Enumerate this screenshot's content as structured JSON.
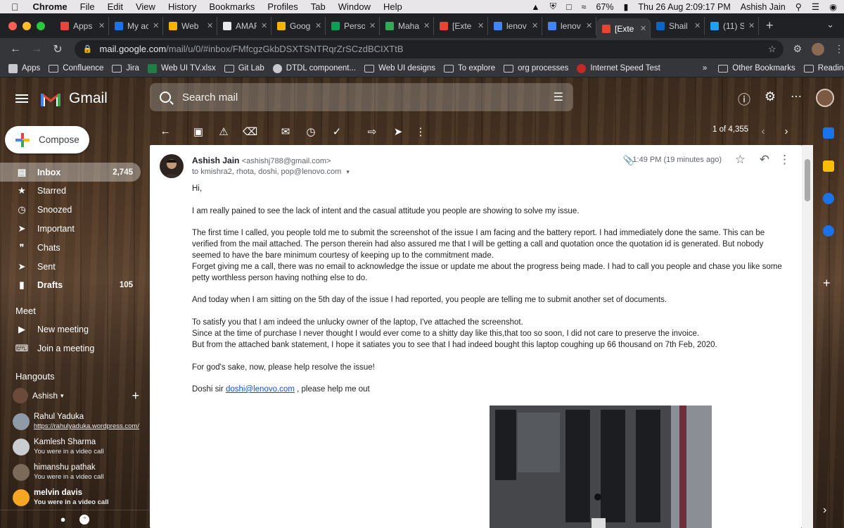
{
  "menubar": {
    "app": "Chrome",
    "items": [
      "File",
      "Edit",
      "View",
      "History",
      "Bookmarks",
      "Profiles",
      "Tab",
      "Window",
      "Help"
    ],
    "battery": "67%",
    "datetime": "Thu 26 Aug  2:09:17 PM",
    "user": "Ashish Jain"
  },
  "tabs": [
    {
      "label": "Apps",
      "color": "#e8453c"
    },
    {
      "label": "My ac",
      "color": "#1a73e8"
    },
    {
      "label": "Web",
      "color": "#f4b400"
    },
    {
      "label": "AMAF",
      "color": "#e8eaed"
    },
    {
      "label": "Goog",
      "color": "#f4b400"
    },
    {
      "label": "Perso",
      "color": "#0f9d58"
    },
    {
      "label": "Maha",
      "color": "#34a853"
    },
    {
      "label": "[Exte",
      "color": "#ea4335"
    },
    {
      "label": "lenov",
      "color": "#4285f4"
    },
    {
      "label": "lenov",
      "color": "#4285f4"
    },
    {
      "label": "[Exte",
      "color": "#ea4335"
    },
    {
      "label": "Shail",
      "color": "#0a66c2"
    },
    {
      "label": "(11) S",
      "color": "#1da1f2"
    }
  ],
  "address": {
    "host": "mail.google.com",
    "path": "/mail/u/0/#inbox/FMfcgzGkbDSXTSNTRqrZrSCzdBCIXTtB"
  },
  "bookmarks": [
    "Apps",
    "Confluence",
    "Jira",
    "Web UI TV.xlsx",
    "Git Lab",
    "DTDL component...",
    "Web UI designs",
    "To explore",
    "org processes",
    "Internet Speed Test"
  ],
  "bookmarks_more": "»",
  "bookmarks_right": [
    "Other Bookmarks",
    "Reading List"
  ],
  "gmail": {
    "logo": "Gmail",
    "search_placeholder": "Search mail",
    "compose": "Compose"
  },
  "nav": [
    {
      "label": "Inbox",
      "count": "2,745",
      "icon": "inbox-icon"
    },
    {
      "label": "Starred",
      "count": "",
      "icon": "star-icon"
    },
    {
      "label": "Snoozed",
      "count": "",
      "icon": "clock-icon"
    },
    {
      "label": "Important",
      "count": "",
      "icon": "important-icon"
    },
    {
      "label": "Chats",
      "count": "",
      "icon": "chat-icon"
    },
    {
      "label": "Sent",
      "count": "",
      "icon": "send-icon"
    },
    {
      "label": "Drafts",
      "count": "105",
      "icon": "draft-icon"
    }
  ],
  "meet": {
    "title": "Meet",
    "new_meeting": "New meeting",
    "join_meeting": "Join a meeting"
  },
  "hangouts": {
    "title": "Hangouts",
    "me": "Ashish",
    "contacts": [
      {
        "name": "Rahul Yaduka",
        "status": "https://rahulyaduka.wordpress.com/",
        "color": "#8e9aa6"
      },
      {
        "name": "Kamlesh Sharma",
        "status": "You were in a video call",
        "color": "#c9ccd0"
      },
      {
        "name": "himanshu pathak",
        "status": "You were in a video call",
        "color": "#7b6a5a"
      },
      {
        "name": "melvin davis",
        "status": "You were in a video call",
        "color": "#f5a623"
      }
    ]
  },
  "pager": "1 of 4,355",
  "email": {
    "sender_name": "Ashish Jain",
    "sender_email": "<ashishj788@gmail.com>",
    "to": "to kmishra2, rhota, doshi, pop@lenovo.com",
    "time": "1:49 PM (19 minutes ago)",
    "greeting": "Hi,",
    "p1": "I am really pained to see the lack of intent and the casual attitude you people are showing to solve my issue.",
    "p2": "The first time I called, you people told me to submit the screenshot of the issue I am facing and the battery report. I had immediately done the same. This can be verified from the mail attached. The person therein had also assured me that I will be getting a call and quotation once the quotation id is generated. But nobody seemed to have the bare minimum courtesy of keeping up to the commitment made.",
    "p3": "Forget giving me a call, there was no email to acknowledge the issue or update me about the progress being made. I had to call you people and chase you like some petty worthless person having nothing else to do.",
    "p4": "And today when I am sitting on the 5th day of the issue I had reported, you people are telling me to submit another set of documents.",
    "p5a": "To satisfy you that I am indeed the unlucky owner of the laptop, I've attached the screenshot.",
    "p5b": "Since at the time of purchase I never thought I would ever come to a shitty day like this,that too so soon, I did not care to preserve the invoice.",
    "p5c": "But from the attached bank statement, I hope it satiates you to see that I had indeed bought this laptop coughing up 66 thousand on 7th Feb, 2020.",
    "p6": "For god's sake, now, please help resolve the issue!",
    "p7_pre": "Doshi sir ",
    "p7_link": "doshi@lenovo.com",
    "p7_post": " , please help me out"
  }
}
